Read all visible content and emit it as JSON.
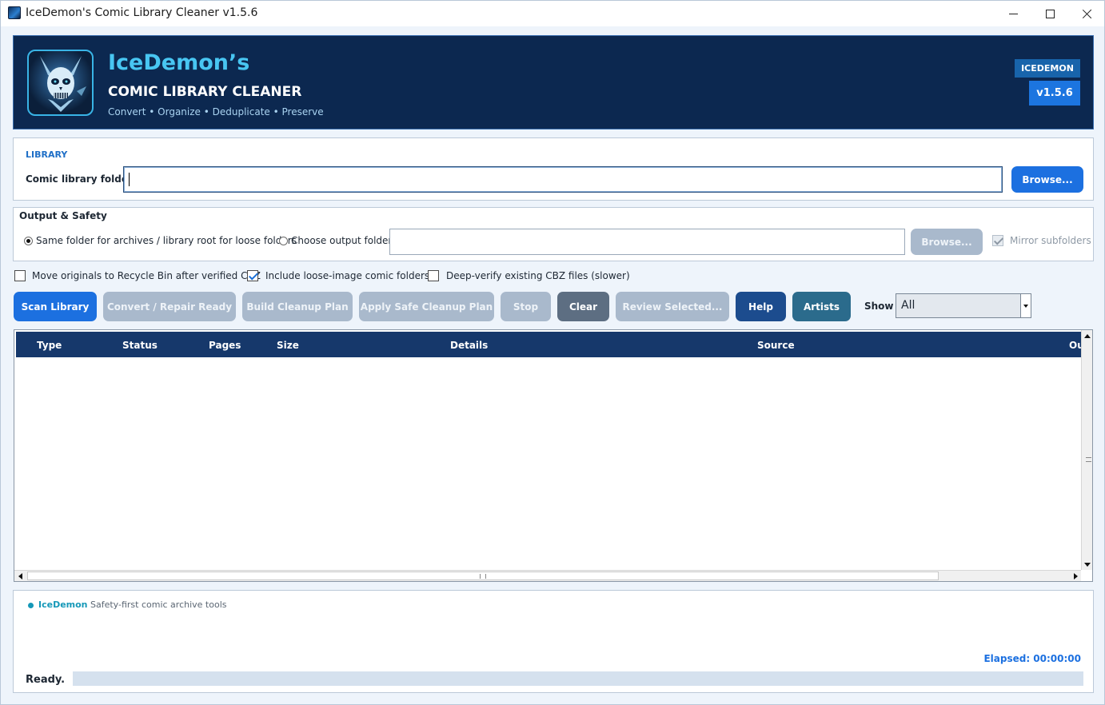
{
  "window": {
    "title": "IceDemon's Comic Library Cleaner v1.5.6"
  },
  "banner": {
    "brand_name": "IceDemon’s",
    "subtitle": "COMIC LIBRARY CLEANER",
    "tagline": "Convert • Organize • Deduplicate • Preserve",
    "badge_name": "ICEDEMON",
    "badge_version": "v1.5.6",
    "logo_icon": "demon-skull-logo-icon"
  },
  "library": {
    "section_label": "LIBRARY",
    "field_label": "Comic library folder",
    "folder_value": "",
    "browse_label": "Browse..."
  },
  "output": {
    "title": "Output & Safety",
    "radio_same_label": "Same folder for archives / library root for loose folders",
    "radio_same_selected": true,
    "radio_choose_label": "Choose output folder:",
    "radio_choose_selected": false,
    "output_folder_value": "",
    "browse_label": "Browse...",
    "mirror_label": "Mirror subfolders",
    "mirror_checked": true
  },
  "options": {
    "recycle_label": "Move originals to Recycle Bin after verified CBZ",
    "recycle_checked": false,
    "loose_label": "Include loose-image comic folders",
    "loose_checked": true,
    "deepverify_label": "Deep-verify existing CBZ files (slower)",
    "deepverify_checked": false
  },
  "toolbar": {
    "scan": "Scan Library",
    "convert": "Convert / Repair Ready",
    "build": "Build Cleanup Plan",
    "apply": "Apply Safe Cleanup Plan",
    "stop": "Stop",
    "clear": "Clear",
    "review": "Review Selected...",
    "help": "Help",
    "artists": "Artists",
    "show_label": "Show",
    "show_value": "All"
  },
  "table": {
    "columns": [
      "Type",
      "Status",
      "Pages",
      "Size",
      "Details",
      "Source",
      "Ou"
    ],
    "rows": []
  },
  "footer": {
    "brand": "IceDemon",
    "tagline": "Safety-first comic archive tools",
    "elapsed": "Elapsed: 00:00:00",
    "status": "Ready.",
    "progress": 0
  },
  "colors": {
    "banner_bg": "#0c2850",
    "accent": "#1c70e0",
    "brand_cyan": "#48c6f2",
    "table_header": "#16386b",
    "disabled_button": "#a9b9cc"
  }
}
